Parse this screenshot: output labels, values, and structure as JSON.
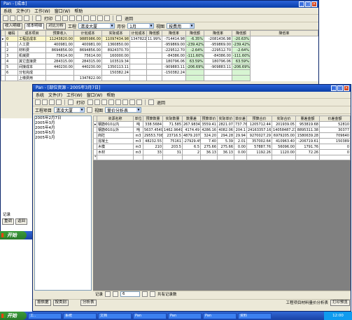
{
  "back_window": {
    "title": "Pan - [成本]",
    "menu": [
      "系统",
      "文件(F)",
      "工作(W)",
      "窗口(W)",
      "帮助"
    ],
    "toolbar": {
      "print_label": "打印",
      "exit_label": "退回"
    },
    "tabs": [
      "收入明细",
      "成本明细",
      "对比分析"
    ],
    "filter": {
      "project_label": "工程",
      "project_value": "清凌大厦",
      "month_label": "月份",
      "month_value": "1月",
      "view_label": "视图",
      "view_value": "按费用"
    },
    "headers_top": [
      "本月数",
      "计划 比较",
      "预算",
      "实际 比较",
      "实际比较"
    ],
    "headers": [
      "编码",
      "成本项目",
      "预算收入",
      "计划成本",
      "实际成本",
      "计划成本",
      "降低额",
      "降低率",
      "降低额",
      "降低率",
      "降低额",
      "降低率"
    ],
    "rows": [
      {
        "code": "0",
        "name": "工程总成本",
        "v": [
          "11243820.00",
          "9885986.00",
          "11097434.98",
          "1347822.00",
          "11.99%",
          "-714414.98",
          "-6.35%",
          "-2081436.98",
          "-20.63%"
        ],
        "sel": true
      },
      {
        "code": "1",
        "name": "人工费",
        "v": [
          "400981.00",
          "400981.00",
          "1360850.00",
          "",
          "",
          "-959869.00",
          "-239.42%",
          "-959869.00",
          "-239.42%"
        ]
      },
      {
        "code": "2",
        "name": "材料费",
        "v": [
          "8694856.00",
          "8694856.00",
          "8924370.70",
          "",
          "",
          "-229512.70",
          "-2.64%",
          "-229512.70",
          "-2.64%"
        ]
      },
      {
        "code": "3",
        "name": "机械费",
        "v": [
          "75614.00",
          "75614.00",
          "160000.00",
          "",
          "",
          "-84386.00",
          "-111.60%",
          "-84386.00",
          "-111.60%"
        ]
      },
      {
        "code": "4",
        "name": "其它直接费",
        "v": [
          "284315.00",
          "284315.00",
          "103519.34",
          "",
          "",
          "180796.06",
          "63.59%",
          "180796.06",
          "63.59%"
        ]
      },
      {
        "code": "5",
        "name": "间接成本",
        "v": [
          "440230.00",
          "440230.00",
          "1350113.11",
          "",
          "",
          "-909883.11",
          "-206.69%",
          "-909883.11",
          "-206.69%"
        ]
      },
      {
        "code": "6",
        "name": "分包完成",
        "v": [
          "",
          "",
          "150382.24",
          "",
          "",
          "-150382.24",
          "",
          "",
          ""
        ]
      },
      {
        "code": "",
        "name": "上缴费用",
        "v": [
          "",
          "1347822.00",
          "",
          "",
          "",
          "",
          "",
          "",
          ""
        ]
      }
    ],
    "bottom_buttons": [
      "重调",
      "返回"
    ],
    "record_label": "记录"
  },
  "front_window": {
    "title": "Pan - [部位资源 - 2005年3月7日]",
    "menu": [
      "系统",
      "文件(F)",
      "工作(W)",
      "窗口(W)",
      "帮助"
    ],
    "toolbar": {
      "print_label": "打印",
      "exit_label": "退回"
    },
    "filter": {
      "project_label": "工程项目",
      "project_value": "清凌大厦",
      "view_label": "视图",
      "view_value": "量价分析表"
    },
    "tree": [
      "2005年2月7日",
      "2005年3月",
      "2005年4月",
      "2005年5月",
      "2005年1月"
    ],
    "headers": [
      "",
      "资源名称",
      "单位",
      "预算数量",
      "实际数量",
      "数量差",
      "预算单价",
      "实际单价",
      "单价差",
      "预算合价",
      "实际合价",
      "量差金额",
      "价差金额"
    ],
    "rows": [
      {
        "name": "钢筋Φ10以内",
        "unit": "吨",
        "v": [
          "338.5684",
          "71.585",
          "267.9834",
          "3559.41",
          "2821.07",
          "737.76",
          "1205712.44",
          "201939.05",
          "953819.68",
          "52810"
        ]
      },
      {
        "name": "钢筋Φ10以外",
        "unit": "吨",
        "v": [
          "5637.4549",
          "1462.9649",
          "4174.49",
          "4286.16",
          "4082.06",
          "204.1",
          "24163357.16",
          "14058487.27",
          "8895311.38",
          "30377"
        ]
      },
      {
        "name": "商砼",
        "unit": "m3",
        "v": [
          "29553.708",
          "23716.5",
          "4879.2070",
          "324.20",
          "294.28",
          "29.94",
          "9270027.29",
          "6979205.00",
          "1580639.28",
          "709640"
        ]
      },
      {
        "name": "混凝土",
        "unit": "m3",
        "v": [
          "48232.55",
          "75161",
          "-27929.45",
          "7.40",
          "5.39",
          "2.01",
          "357002.64",
          "410963.40",
          "-206719.61",
          "150389"
        ]
      },
      {
        "name": "木模",
        "unit": "m3",
        "v": [
          "210",
          "203.5",
          "6.5",
          "275.66",
          "275.66",
          "0.00",
          "57887.76",
          "56096.00",
          "1791.76",
          "0"
        ]
      },
      {
        "name": "木材",
        "unit": "m3",
        "v": [
          "33",
          "31",
          "2",
          "36.13",
          "36.13",
          "0.00",
          "1192.26",
          "1120.00",
          "72.26",
          "0"
        ]
      }
    ],
    "record_label": "记录",
    "pager_text": "共有记录数",
    "pager_count": "6",
    "bottom_buttons": [
      "按依据",
      "按类别",
      "分析表"
    ],
    "status_text": "工程项目材料量价分析表",
    "print_button": "打印预览"
  },
  "taskbar": {
    "start_label": "开始",
    "tasks": [
      "工..",
      "系统",
      "文档",
      "Pan",
      "Pan",
      "Pan",
      "资料"
    ],
    "clock": "12:00"
  }
}
